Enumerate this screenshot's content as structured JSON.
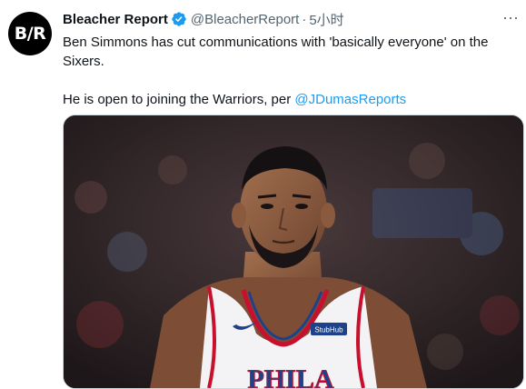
{
  "tweet": {
    "author_name": "Bleacher Report",
    "author_handle": "@BleacherReport",
    "separator": "·",
    "timestamp": "5小时",
    "avatar_text": "B/R",
    "text_line1": "Ben Simmons has cut communications with 'basically everyone' on the Sixers.",
    "text_line2_prefix": "He is open to joining the Warriors, per ",
    "mention": "@JDumasReports",
    "more_icon": "···",
    "verified_icon": "verified-badge-icon"
  },
  "media": {
    "jersey_text": "PHILA",
    "sponsor_patch": "StubHub",
    "colors": {
      "jersey": "#f3f3f5",
      "trim_red": "#c8102e",
      "trim_blue": "#1d428a",
      "background": "#2a2226"
    }
  },
  "colors": {
    "link": "#1d9bf0",
    "secondary_text": "#536471",
    "verified": "#1d9bf0"
  }
}
